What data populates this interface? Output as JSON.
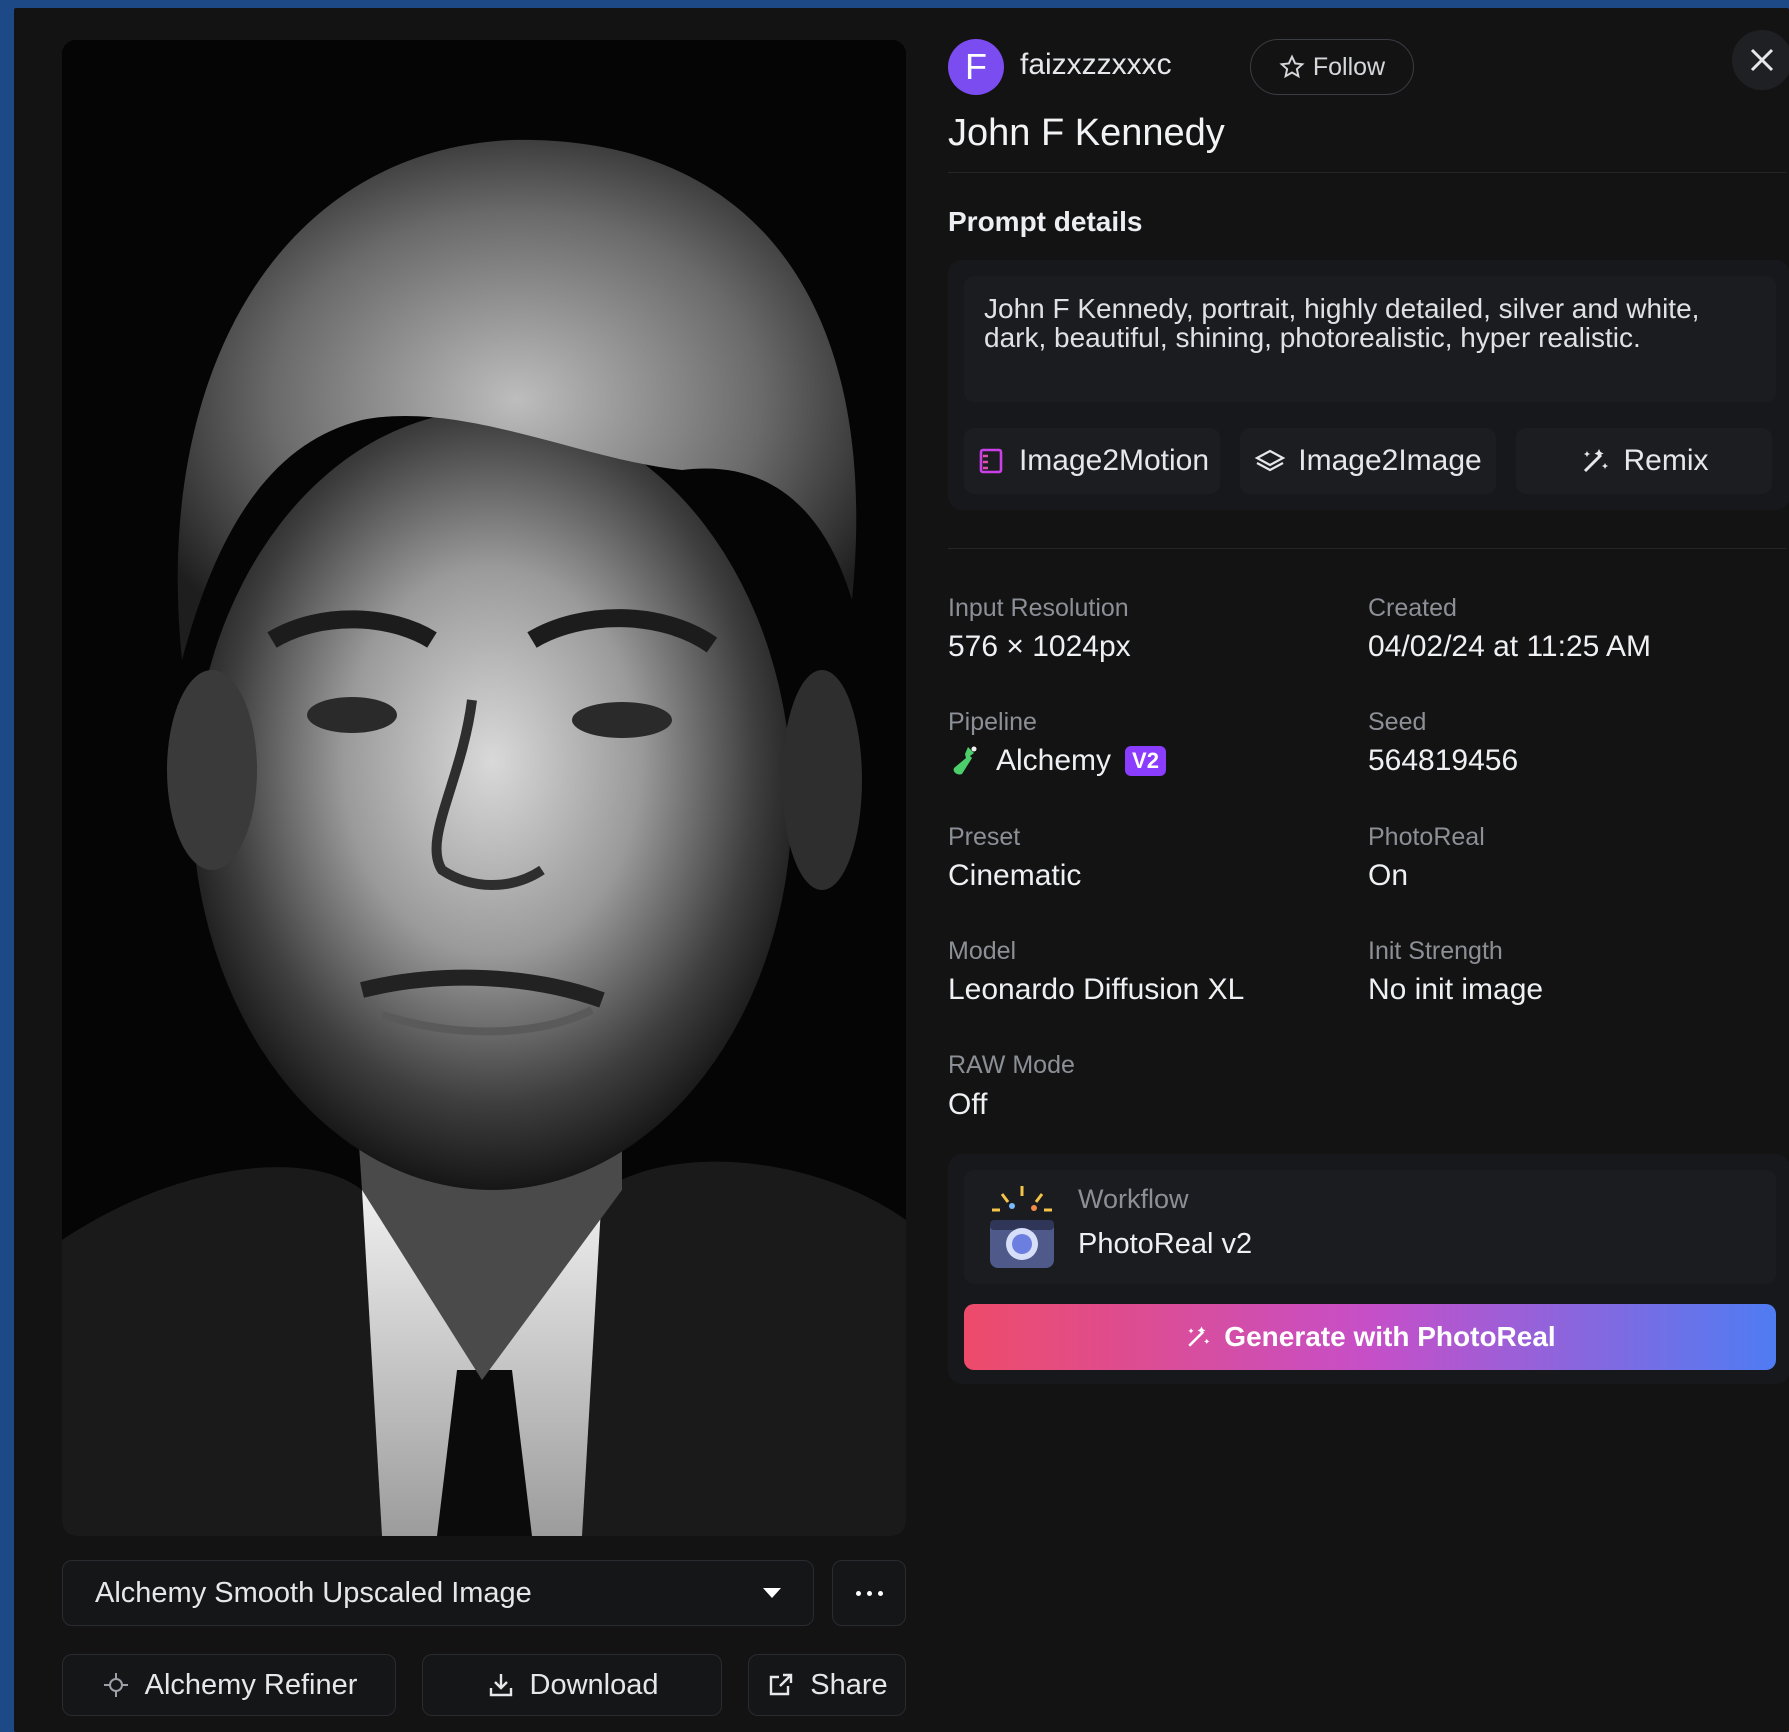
{
  "user": {
    "avatar_letter": "F",
    "username": "faizxzzxxxc",
    "follow_label": "Follow",
    "avatar_color": "#7b4cf0"
  },
  "title": "John F Kennedy",
  "prompt": {
    "heading": "Prompt details",
    "text": "John F Kennedy, portrait, highly detailed, silver and white, dark, beautiful, shining, photorealistic, hyper realistic."
  },
  "tools": [
    {
      "label": "Image2Motion",
      "icon": "film-icon"
    },
    {
      "label": "Image2Image",
      "icon": "layers-icon"
    },
    {
      "label": "Remix",
      "icon": "magic-wand-icon"
    }
  ],
  "details": {
    "input_resolution": {
      "label": "Input Resolution",
      "value": "576 × 1024px"
    },
    "created": {
      "label": "Created",
      "value": "04/02/24 at 11:25 AM"
    },
    "pipeline": {
      "label": "Pipeline",
      "value": "Alchemy",
      "badge": "V2"
    },
    "seed": {
      "label": "Seed",
      "value": "564819456"
    },
    "preset": {
      "label": "Preset",
      "value": "Cinematic"
    },
    "photoreal": {
      "label": "PhotoReal",
      "value": "On"
    },
    "model": {
      "label": "Model",
      "value": "Leonardo Diffusion XL"
    },
    "init_strength": {
      "label": "Init Strength",
      "value": "No init image"
    },
    "raw_mode": {
      "label": "RAW Mode",
      "value": "Off"
    }
  },
  "workflow": {
    "label": "Workflow",
    "value": "PhotoReal v2",
    "generate_label": "Generate with PhotoReal"
  },
  "image_panel": {
    "variant_label": "Alchemy Smooth Upscaled Image",
    "refiner_label": "Alchemy Refiner",
    "download_label": "Download",
    "share_label": "Share"
  },
  "colors": {
    "accent_purple": "#8b3dff",
    "gradient_start": "#ee4b6a",
    "gradient_end": "#4f7cf3",
    "background": "#131313"
  }
}
